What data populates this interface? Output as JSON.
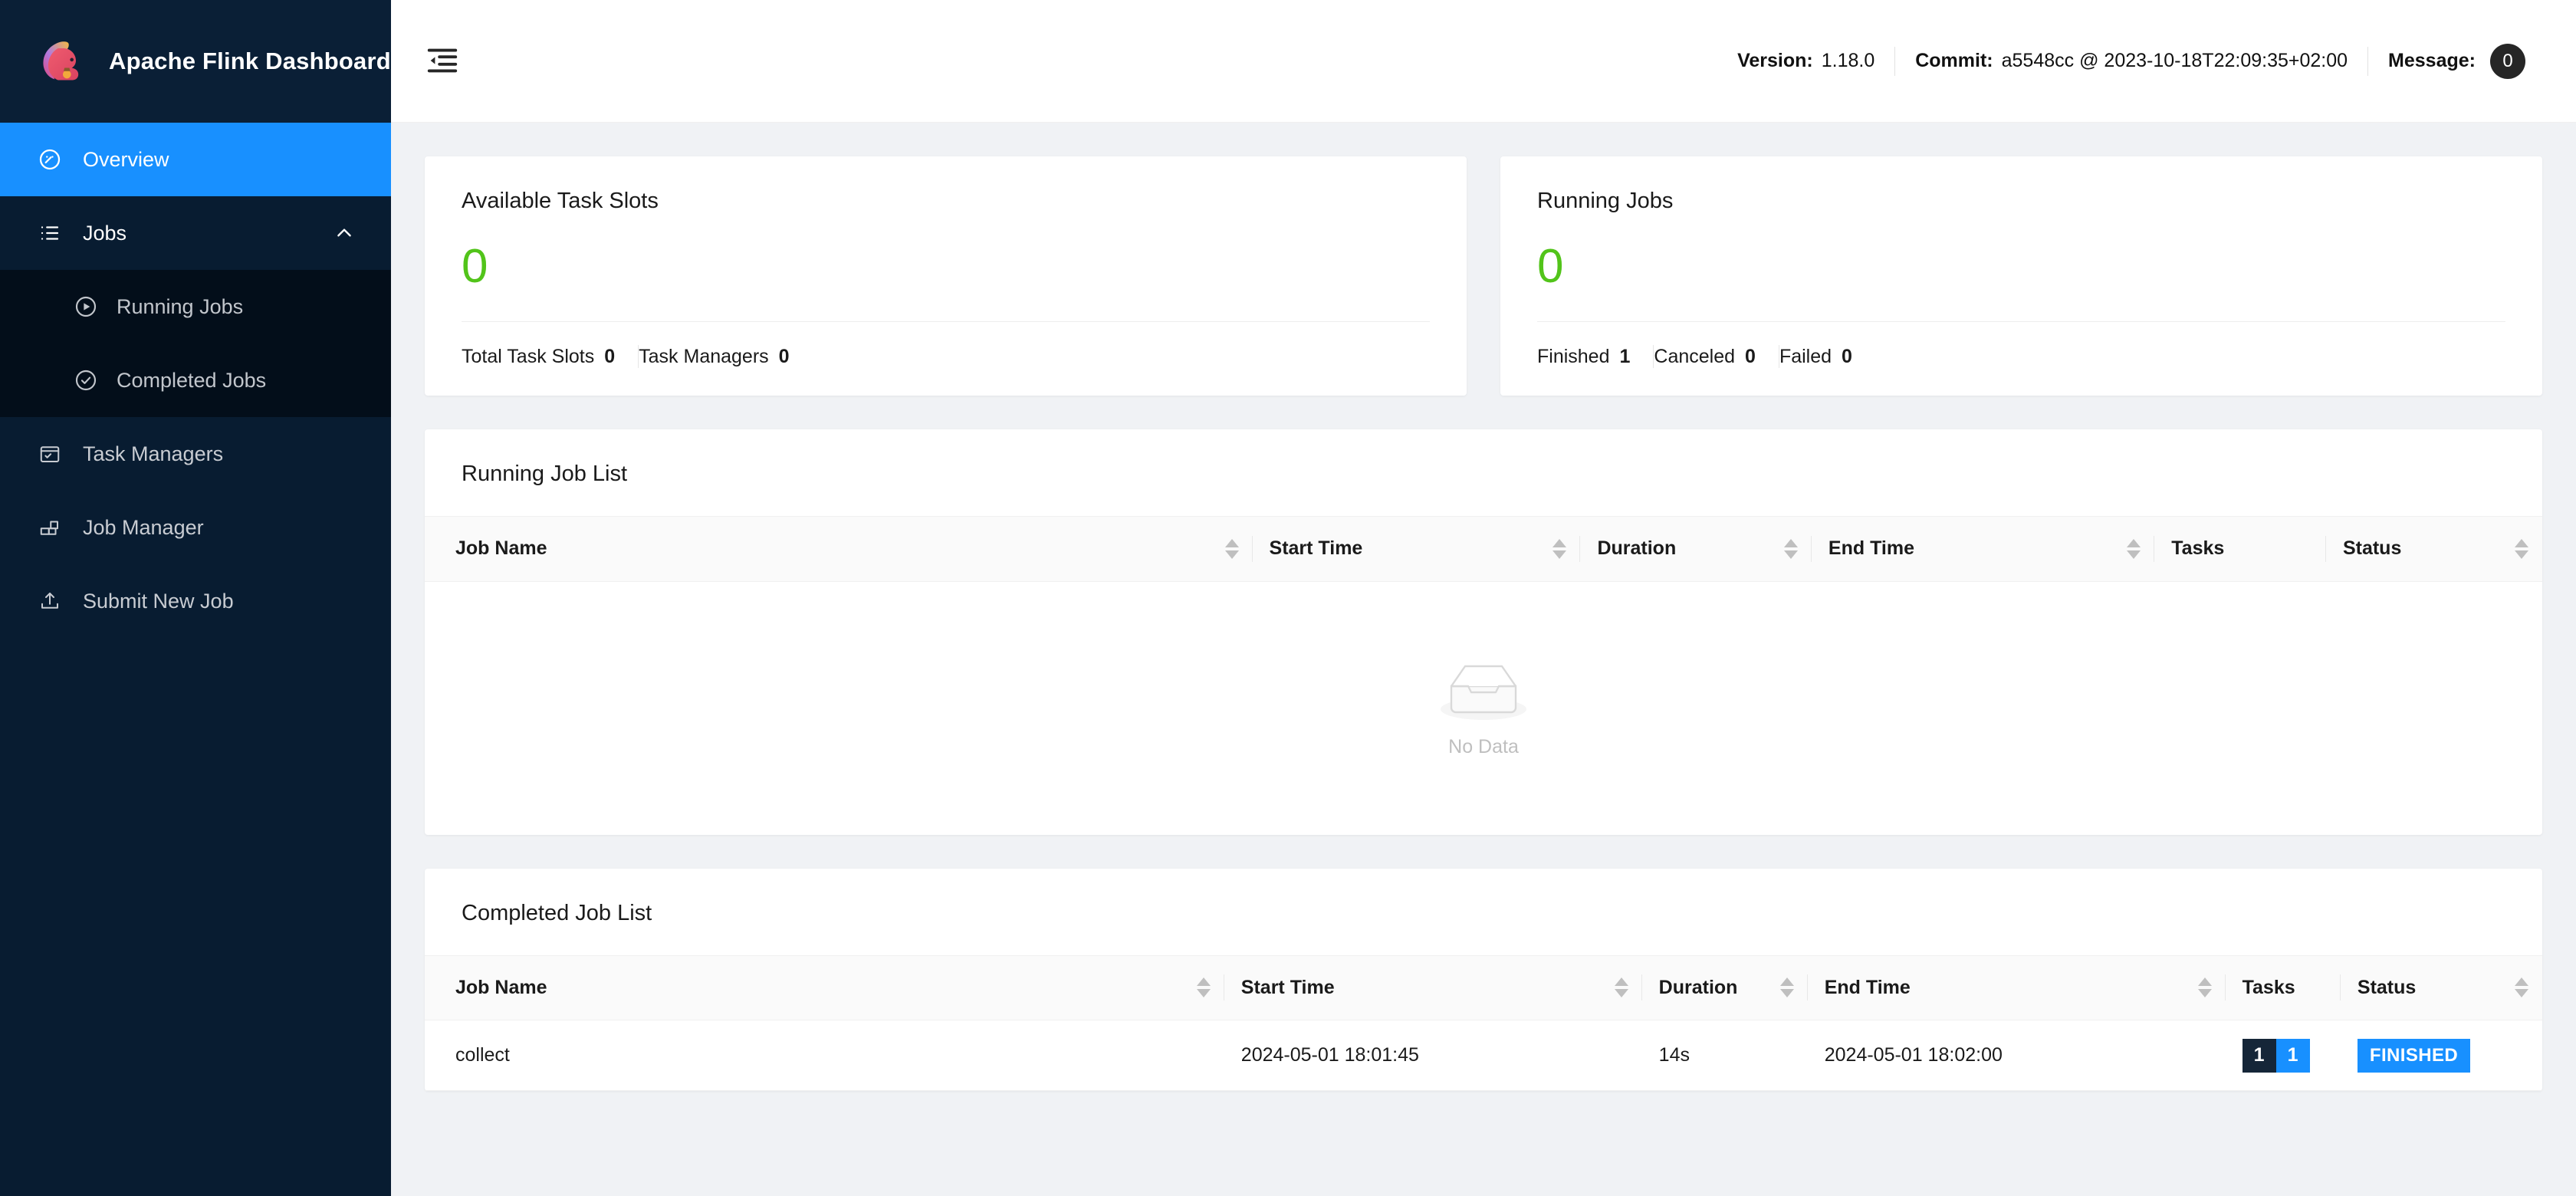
{
  "brand": {
    "title": "Apache Flink Dashboard",
    "logo_icon": "flink-squirrel-logo"
  },
  "sidebar": {
    "items": [
      {
        "label": "Overview",
        "icon": "dashboard-icon",
        "active": true
      },
      {
        "label": "Jobs",
        "icon": "ordered-list-icon",
        "expanded": true,
        "chevron": "chevron-up-icon"
      },
      {
        "label": "Task Managers",
        "icon": "task-managers-icon",
        "active": false
      },
      {
        "label": "Job Manager",
        "icon": "job-manager-icon",
        "active": false
      },
      {
        "label": "Submit New Job",
        "icon": "upload-icon",
        "active": false
      }
    ],
    "submenu": [
      {
        "label": "Running Jobs",
        "icon": "play-circle-icon"
      },
      {
        "label": "Completed Jobs",
        "icon": "check-circle-icon"
      }
    ]
  },
  "topbar": {
    "menu_toggle_icon": "menu-fold-icon",
    "version_label": "Version:",
    "version_value": "1.18.0",
    "commit_label": "Commit:",
    "commit_value": "a5548cc @ 2023-10-18T22:09:35+02:00",
    "message_label": "Message:",
    "message_count": "0"
  },
  "cards": {
    "task_slots": {
      "title": "Available Task Slots",
      "value": "0",
      "value_color": "#52c41a",
      "footer": [
        {
          "label": "Total Task Slots",
          "value": "0"
        },
        {
          "label": "Task Managers",
          "value": "0"
        }
      ]
    },
    "running_jobs": {
      "title": "Running Jobs",
      "value": "0",
      "value_color": "#52c41a",
      "footer": [
        {
          "label": "Finished",
          "value": "1"
        },
        {
          "label": "Canceled",
          "value": "0"
        },
        {
          "label": "Failed",
          "value": "0"
        }
      ]
    }
  },
  "running_job_list": {
    "title": "Running Job List",
    "columns": [
      "Job Name",
      "Start Time",
      "Duration",
      "End Time",
      "Tasks",
      "Status"
    ],
    "rows": [],
    "empty_text": "No Data",
    "empty_icon": "empty-inbox-icon"
  },
  "completed_job_list": {
    "title": "Completed Job List",
    "columns": [
      "Job Name",
      "Start Time",
      "Duration",
      "End Time",
      "Tasks",
      "Status"
    ],
    "rows": [
      {
        "job_name": "collect",
        "start_time": "2024-05-01 18:01:45",
        "duration": "14s",
        "end_time": "2024-05-01 18:02:00",
        "tasks": [
          {
            "value": "1",
            "color": "#152638"
          },
          {
            "value": "1",
            "color": "#1890ff"
          }
        ],
        "status": "FINISHED",
        "status_color": "#1890ff"
      }
    ]
  },
  "theme": {
    "sidebar_bg": "#081c31",
    "submenu_bg": "#030e1a",
    "accent": "#1890ff",
    "page_bg": "#f0f2f5",
    "green": "#52c41a"
  }
}
